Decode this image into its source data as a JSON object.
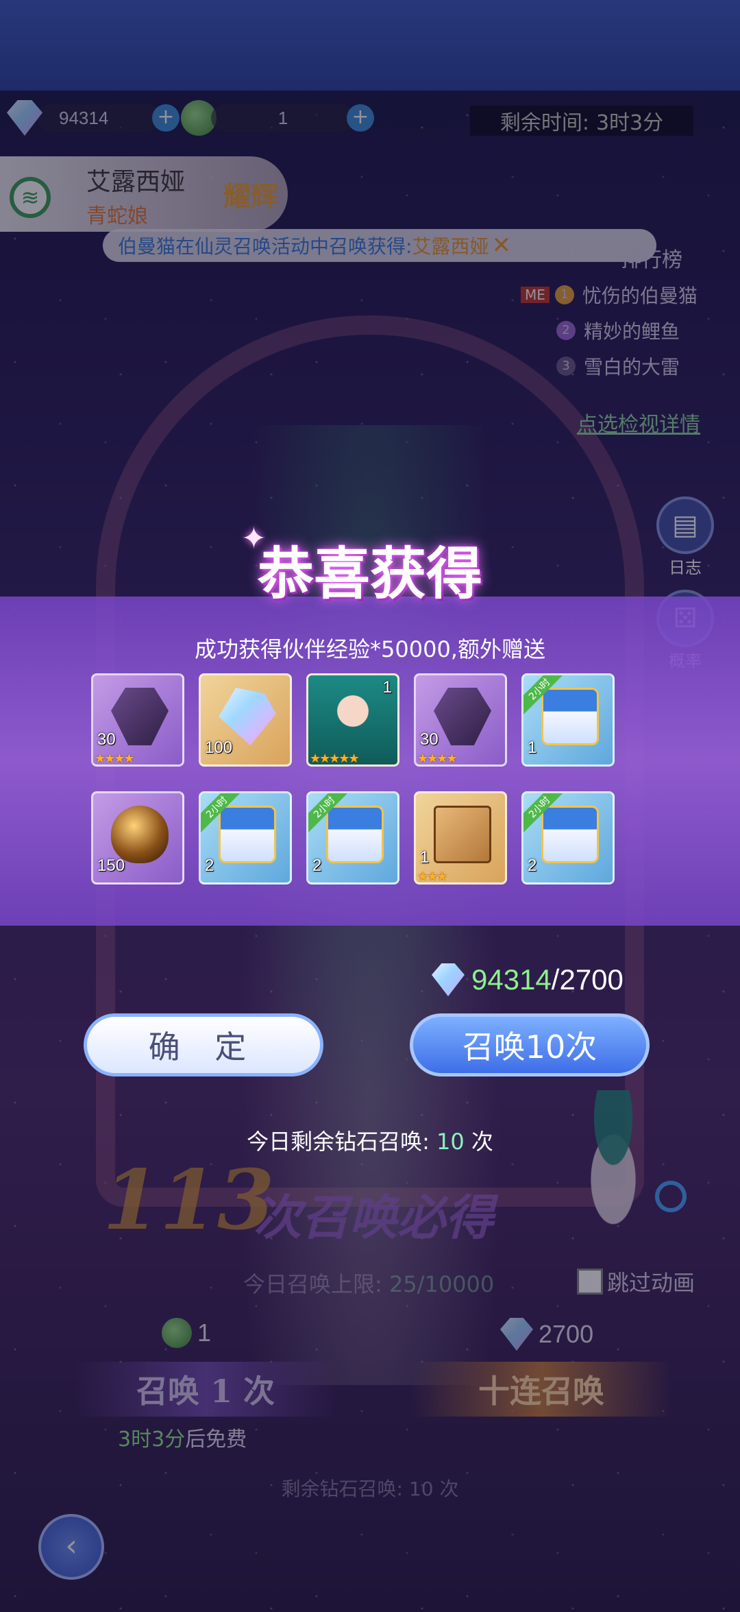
{
  "currency": {
    "diamonds": "94314",
    "tickets": "1"
  },
  "timer": {
    "label": "剩余时间:",
    "value": "3时3分"
  },
  "hero": {
    "name": "艾露西娅",
    "subtitle": "青蛇娘",
    "badge": "耀辉"
  },
  "ticker": {
    "text_prefix": "伯曼猫在仙灵召唤活动中召唤获得:",
    "highlight": "艾露西娅"
  },
  "ranking": {
    "title": "排行榜",
    "me_label": "ME",
    "entries": [
      {
        "rank": "1",
        "name": "忧伤的伯曼猫"
      },
      {
        "rank": "2",
        "name": "精妙的鲤鱼"
      },
      {
        "rank": "3",
        "name": "雪白的大雷"
      }
    ],
    "details_link": "点选检视详情"
  },
  "side_buttons": {
    "log": "日志",
    "probability": "概率"
  },
  "reward": {
    "title": "恭喜获得",
    "subtitle": "成功获得伙伴经验*50000,额外赠送",
    "items": [
      {
        "type": "crystal",
        "count": "30",
        "stars": "★★★★",
        "tag": "",
        "bg": "purple"
      },
      {
        "type": "gem",
        "count": "100",
        "stars": "",
        "tag": "",
        "bg": "orange"
      },
      {
        "type": "portrait",
        "count": "1",
        "stars": "★★★★★",
        "tag": "",
        "bg": "orange"
      },
      {
        "type": "crystal",
        "count": "30",
        "stars": "★★★★",
        "tag": "",
        "bg": "purple"
      },
      {
        "type": "chest",
        "count": "1",
        "stars": "",
        "tag": "2小时",
        "bg": "blue"
      },
      {
        "type": "egg",
        "count": "150",
        "stars": "",
        "tag": "",
        "bg": "purple"
      },
      {
        "type": "chest",
        "count": "2",
        "stars": "",
        "tag": "2小时",
        "bg": "blue"
      },
      {
        "type": "chest",
        "count": "2",
        "stars": "",
        "tag": "2小时",
        "bg": "blue"
      },
      {
        "type": "box",
        "count": "1",
        "stars": "★★★",
        "tag": "",
        "bg": "orange"
      },
      {
        "type": "chest",
        "count": "2",
        "stars": "",
        "tag": "2小时",
        "bg": "blue"
      }
    ]
  },
  "cost": {
    "have": "94314",
    "sep": "/",
    "need": "2700"
  },
  "buttons": {
    "confirm": "确 定",
    "summon10": "召唤10次"
  },
  "daily": {
    "prefix": "今日剩余钻石召唤:",
    "count": "10",
    "suffix": "次"
  },
  "background": {
    "guarantee_count": "113",
    "guarantee_text": "次召唤必得",
    "limit_prefix": "今日召唤上限:",
    "limit_value": "25/10000",
    "skip_label": "跳过动画",
    "single_cost": "1",
    "ten_cost": "2700",
    "single_btn": "召唤 1 次",
    "ten_btn": "十连召唤",
    "free_time": "3时3分",
    "free_suffix": "后免费",
    "remain_prefix": "剩余钻石召唤:",
    "remain_count": "10",
    "remain_suffix": "次"
  }
}
